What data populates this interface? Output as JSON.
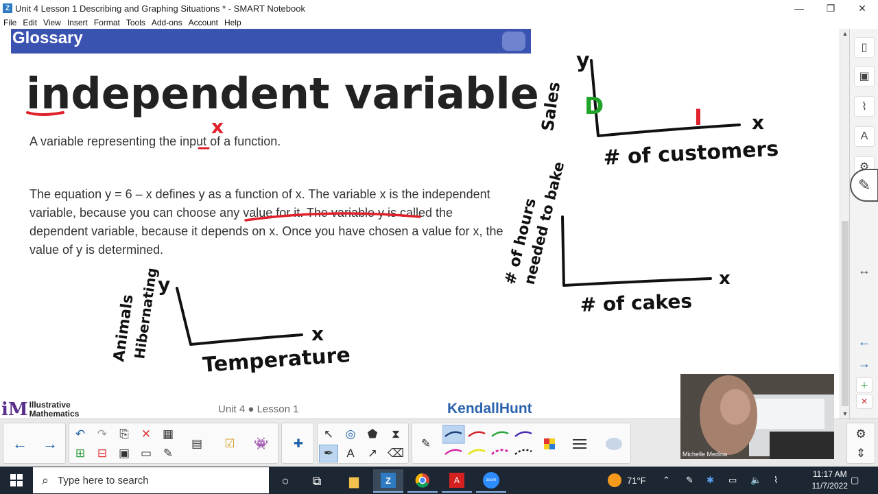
{
  "window": {
    "title": "Unit 4 Lesson 1 Describing and Graphing Situations * - SMART Notebook",
    "app_icon": "smart-notebook-icon",
    "minimize": "—",
    "restore": "❐",
    "close": "✕"
  },
  "menu": [
    "File",
    "Edit",
    "View",
    "Insert",
    "Format",
    "Tools",
    "Add-ons",
    "Account",
    "Help"
  ],
  "slide": {
    "banner": "Glossary",
    "heading": "independent variable",
    "definition": "A variable representing the input of a function.",
    "paragraph": "The equation y = 6 – x defines y as a function of x. The variable x is the independent variable, because you can choose any value for it. The variable y is called the dependent variable, because it depends on x. Once you have chosen a value for x, the value of y is determined.",
    "footer_unit": "Unit 4 ● Lesson 1",
    "im_logo_mark": "iM",
    "im_logo_line1": "Illustrative",
    "im_logo_line2": "Mathematics",
    "publisher": "KendallHunt"
  },
  "handwriting": {
    "x_mark": "x",
    "graph1_y": "y",
    "graph1_x": "x",
    "graph1_ylabel1": "Animals",
    "graph1_ylabel2": "Hibernating",
    "graph1_xlabel": "Temperature",
    "graph2_y": "y",
    "graph2_x": "x",
    "graph2_ylabel": "Sales",
    "graph2_d": "D",
    "graph2_i": "I",
    "graph2_xlabel": "# of customers",
    "graph3_x": "x",
    "graph3_ylabel1": "# of hours",
    "graph3_ylabel2": "needed to bake",
    "graph3_xlabel": "# of cakes"
  },
  "colors": {
    "banner": "#3b53b0",
    "ink_black": "#111111",
    "ink_red": "#e0202a",
    "ink_green": "#1fa32a",
    "publisher_blue": "#2a62ad"
  },
  "side_tools": [
    "page-sorter-icon",
    "gallery-icon",
    "attachments-icon",
    "properties-icon",
    "addons-icon",
    "pen-icon"
  ],
  "side_arrows": [
    "↔",
    "←",
    "→"
  ],
  "toolbar": {
    "prev": "←",
    "next": "→"
  },
  "webcam": {
    "name": "Michelle Medina"
  },
  "taskbar": {
    "search_placeholder": "Type here to search",
    "weather": "71°F",
    "time": "11:17 AM",
    "date": "11/7/2022"
  }
}
